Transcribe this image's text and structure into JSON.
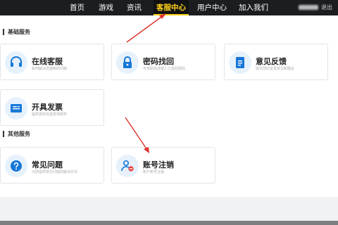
{
  "nav": {
    "items": [
      {
        "label": "首页"
      },
      {
        "label": "游戏"
      },
      {
        "label": "资讯"
      },
      {
        "label": "客服中心"
      },
      {
        "label": "用户中心"
      },
      {
        "label": "加入我们"
      }
    ],
    "logout_label": "退出",
    "active_color": "#ffd21a"
  },
  "sections": {
    "basic": {
      "title": "基础服务",
      "cards": [
        {
          "title": "在线客服",
          "desc": "如何解决您遇到的问题",
          "icon": "headset-icon"
        },
        {
          "title": "密码找回",
          "desc": "可自助完成或人工找回密码",
          "icon": "lock-icon"
        },
        {
          "title": "意见反馈",
          "desc": "提交您的宝贵意见和建议",
          "icon": "document-icon"
        },
        {
          "title": "开具发票",
          "desc": "提供游戏充值发票服务",
          "icon": "invoice-icon"
        }
      ]
    },
    "other": {
      "title": "其他服务",
      "cards": [
        {
          "title": "常见问题",
          "desc": "为您提供常见问题的解决办法",
          "icon": "question-icon"
        },
        {
          "title": "账号注销",
          "desc": "账户账号注销",
          "icon": "user-remove-icon"
        }
      ]
    }
  },
  "colors": {
    "accent_blue": "#1677d8",
    "arrow_red": "#e0312b",
    "remove_red": "#e53935"
  }
}
